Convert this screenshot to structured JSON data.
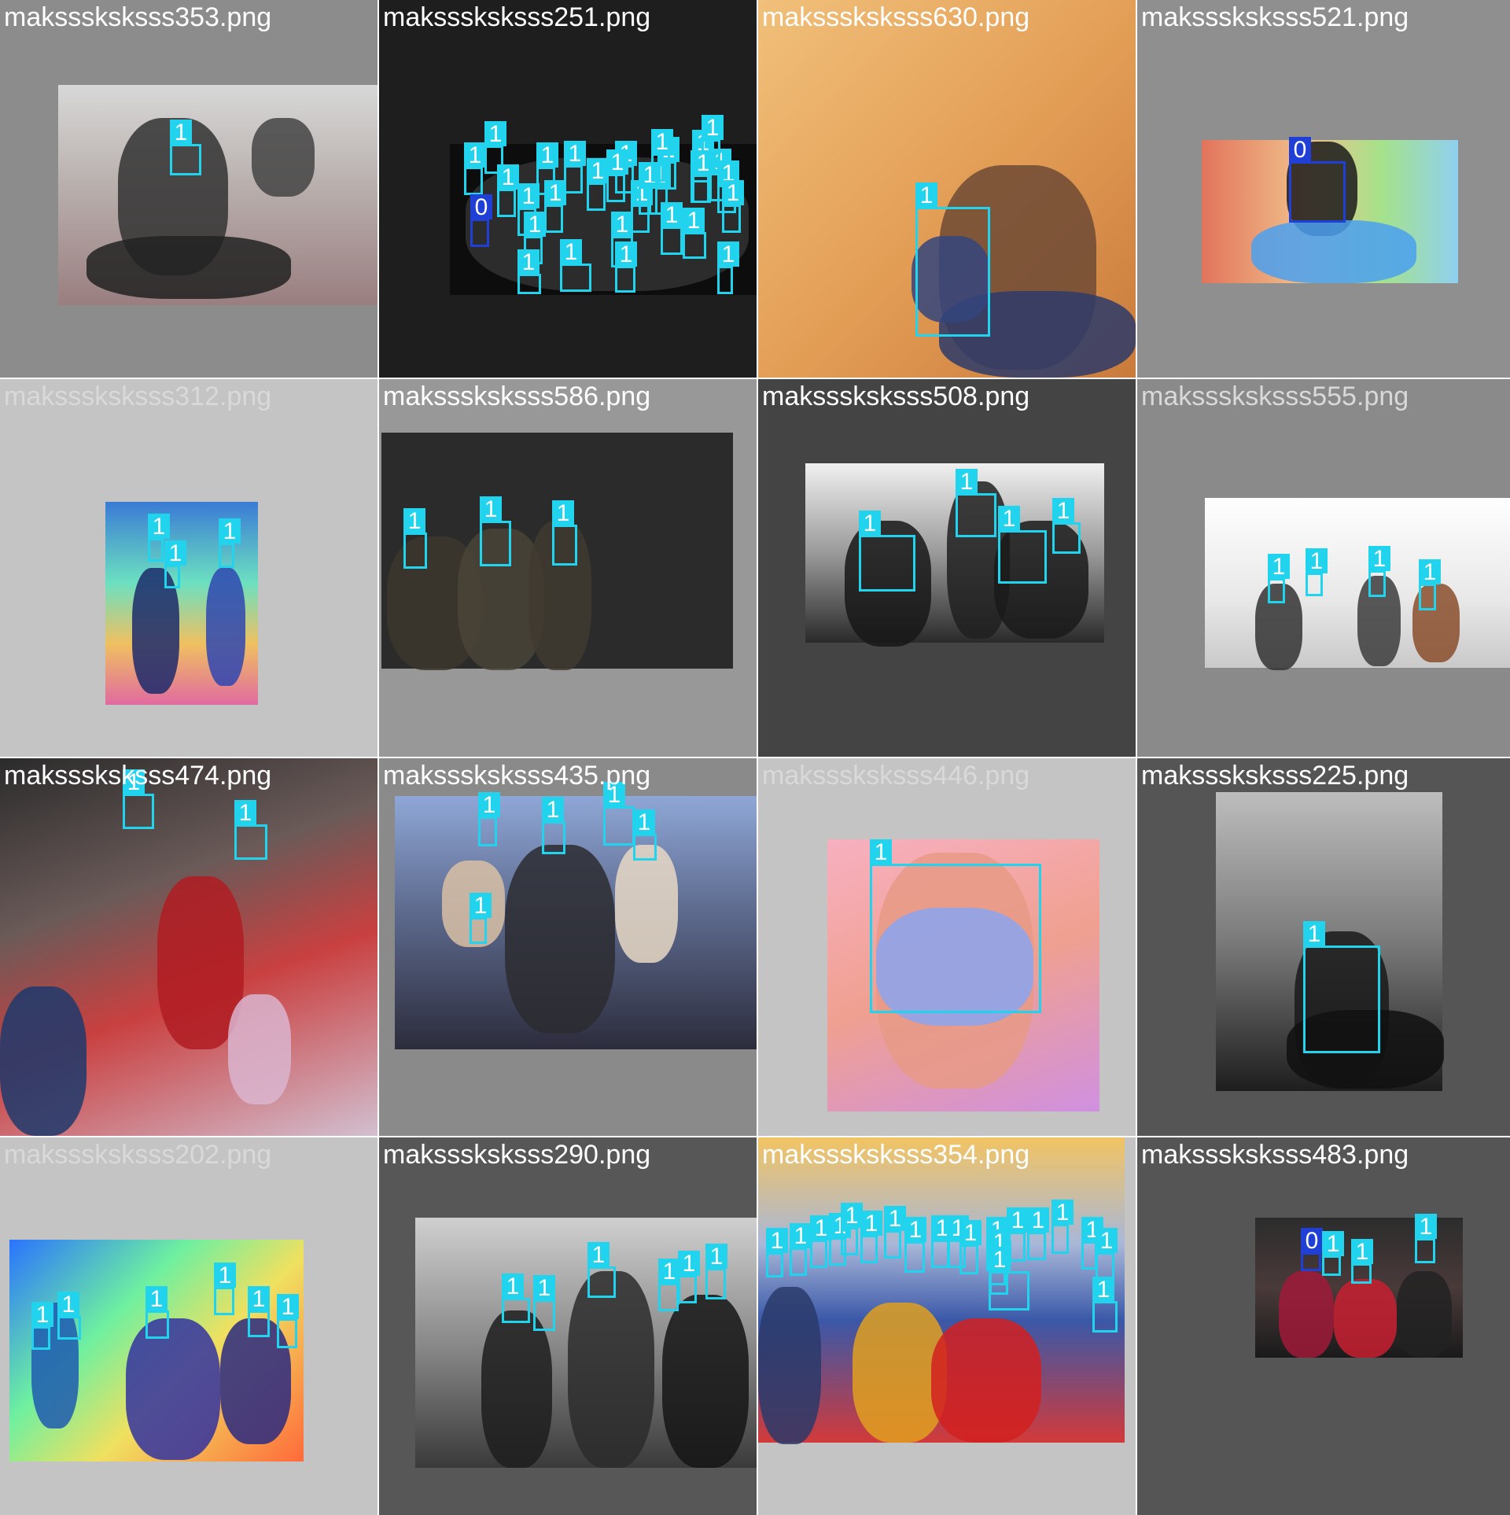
{
  "colors": {
    "class_1": "#22d3ee",
    "class_0": "#1f3fd6",
    "filename_text_light": "#ffffff",
    "filename_text_muted": "#d9d9d9"
  },
  "tiles": [
    {
      "filename": "maksssksksss353.png",
      "labels": [
        "1"
      ]
    },
    {
      "filename": "maksssksksss251.png",
      "labels": [
        "1",
        "1",
        "1",
        "1",
        "0",
        "1",
        "1",
        "1",
        "1",
        "1",
        "1",
        "1",
        "1",
        "1",
        "1",
        "1",
        "1",
        "1",
        "1",
        "1",
        "1",
        "1",
        "1",
        "1",
        "1",
        "1",
        "1",
        "1",
        "1",
        "1",
        "1"
      ]
    },
    {
      "filename": "maksssksksss630.png",
      "labels": [
        "1"
      ]
    },
    {
      "filename": "maksssksksss521.png",
      "labels": [
        "0"
      ]
    },
    {
      "filename": "maksssksksss312.png",
      "labels": [
        "1",
        "1",
        "1"
      ]
    },
    {
      "filename": "maksssksksss586.png",
      "labels": [
        "1",
        "1",
        "1"
      ]
    },
    {
      "filename": "maksssksksss508.png",
      "labels": [
        "1",
        "1",
        "1",
        "1"
      ]
    },
    {
      "filename": "maksssksksss555.png",
      "labels": [
        "1",
        "1",
        "1",
        "1"
      ]
    },
    {
      "filename": "maksssksksss474.png",
      "labels": [
        "1",
        "1"
      ]
    },
    {
      "filename": "maksssksksss435.png",
      "labels": [
        "1",
        "1",
        "1",
        "1",
        "1"
      ]
    },
    {
      "filename": "maksssksksss446.png",
      "labels": [
        "1"
      ]
    },
    {
      "filename": "maksssksksss225.png",
      "labels": [
        "1"
      ]
    },
    {
      "filename": "maksssksksss202.png",
      "labels": [
        "1",
        "1",
        "1",
        "1",
        "1",
        "1"
      ]
    },
    {
      "filename": "maksssksksss290.png",
      "labels": [
        "1",
        "1",
        "1",
        "1",
        "1",
        "1"
      ]
    },
    {
      "filename": "maksssksksss354.png",
      "labels": [
        "1",
        "1",
        "1",
        "1",
        "1",
        "1",
        "1",
        "1",
        "1",
        "1",
        "1",
        "1",
        "1",
        "1",
        "1",
        "1",
        "1",
        "1",
        "1",
        "1"
      ]
    },
    {
      "filename": "maksssksksss483.png",
      "labels": [
        "0",
        "1",
        "1",
        "1"
      ]
    }
  ]
}
